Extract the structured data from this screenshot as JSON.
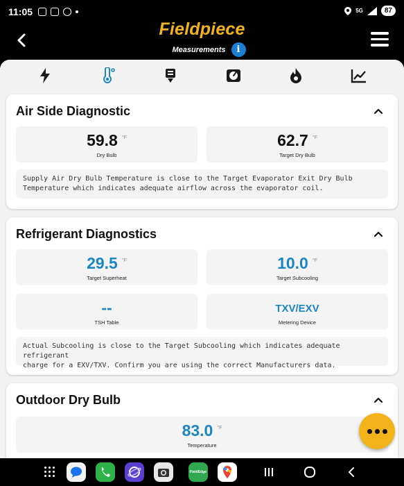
{
  "status_bar": {
    "time": "11:05",
    "network": "5G",
    "battery": "87"
  },
  "header": {
    "brand": "Fieldpiece",
    "subtitle": "Measurements",
    "info_label": "i"
  },
  "tabs": [
    {
      "icon": "lightning-icon",
      "selected": false
    },
    {
      "icon": "thermometer-icon",
      "selected": true
    },
    {
      "icon": "psychrometer-icon",
      "selected": false
    },
    {
      "icon": "gauge-icon",
      "selected": false
    },
    {
      "icon": "flame-icon",
      "selected": false
    },
    {
      "icon": "trend-chart-icon",
      "selected": false
    }
  ],
  "air_side": {
    "title": "Air Side Diagnostic",
    "tile1": {
      "value": "59.8",
      "unit": "°F",
      "label": "Dry Bulb"
    },
    "tile2": {
      "value": "62.7",
      "unit": "°F",
      "label": "Target Dry Bulb"
    },
    "note_line1": "Supply Air Dry Bulb Temperature is close to the Target Evaporator Exit Dry Bulb",
    "note_line2": "Temperature which indicates adequate airflow across the evaporator coil."
  },
  "refrigerant": {
    "title": "Refrigerant Diagnostics",
    "tile1": {
      "value": "29.5",
      "unit": "°F",
      "label": "Target Superheat"
    },
    "tile2": {
      "value": "10.0",
      "unit": "°F",
      "label": "Target Subcooling"
    },
    "tile3": {
      "value": "--",
      "label": "TSH Table"
    },
    "tile4": {
      "value": "TXV/EXV",
      "label": "Metering Device"
    },
    "note_line1": "Actual Subcooling is close to the Target Subcooling which indicates adequate refrigerant",
    "note_line2": "charge for a EXV/TXV. Confirm you are using the correct Manufacturers data."
  },
  "outdoor": {
    "title": "Outdoor Dry Bulb",
    "tile1": {
      "value": "83.0",
      "unit": "°F",
      "label": "Temperature"
    }
  },
  "colors": {
    "brand": "#f2b21a",
    "accent_blue": "#1b86c4",
    "background": "#000000"
  },
  "navbar": {
    "apps": [
      "messages-app-icon",
      "phone-app-icon",
      "browser-app-icon",
      "camera-app-icon",
      "fieldedge-app-icon",
      "maps-app-icon"
    ],
    "fieldedge_label": "FieldEdge"
  }
}
